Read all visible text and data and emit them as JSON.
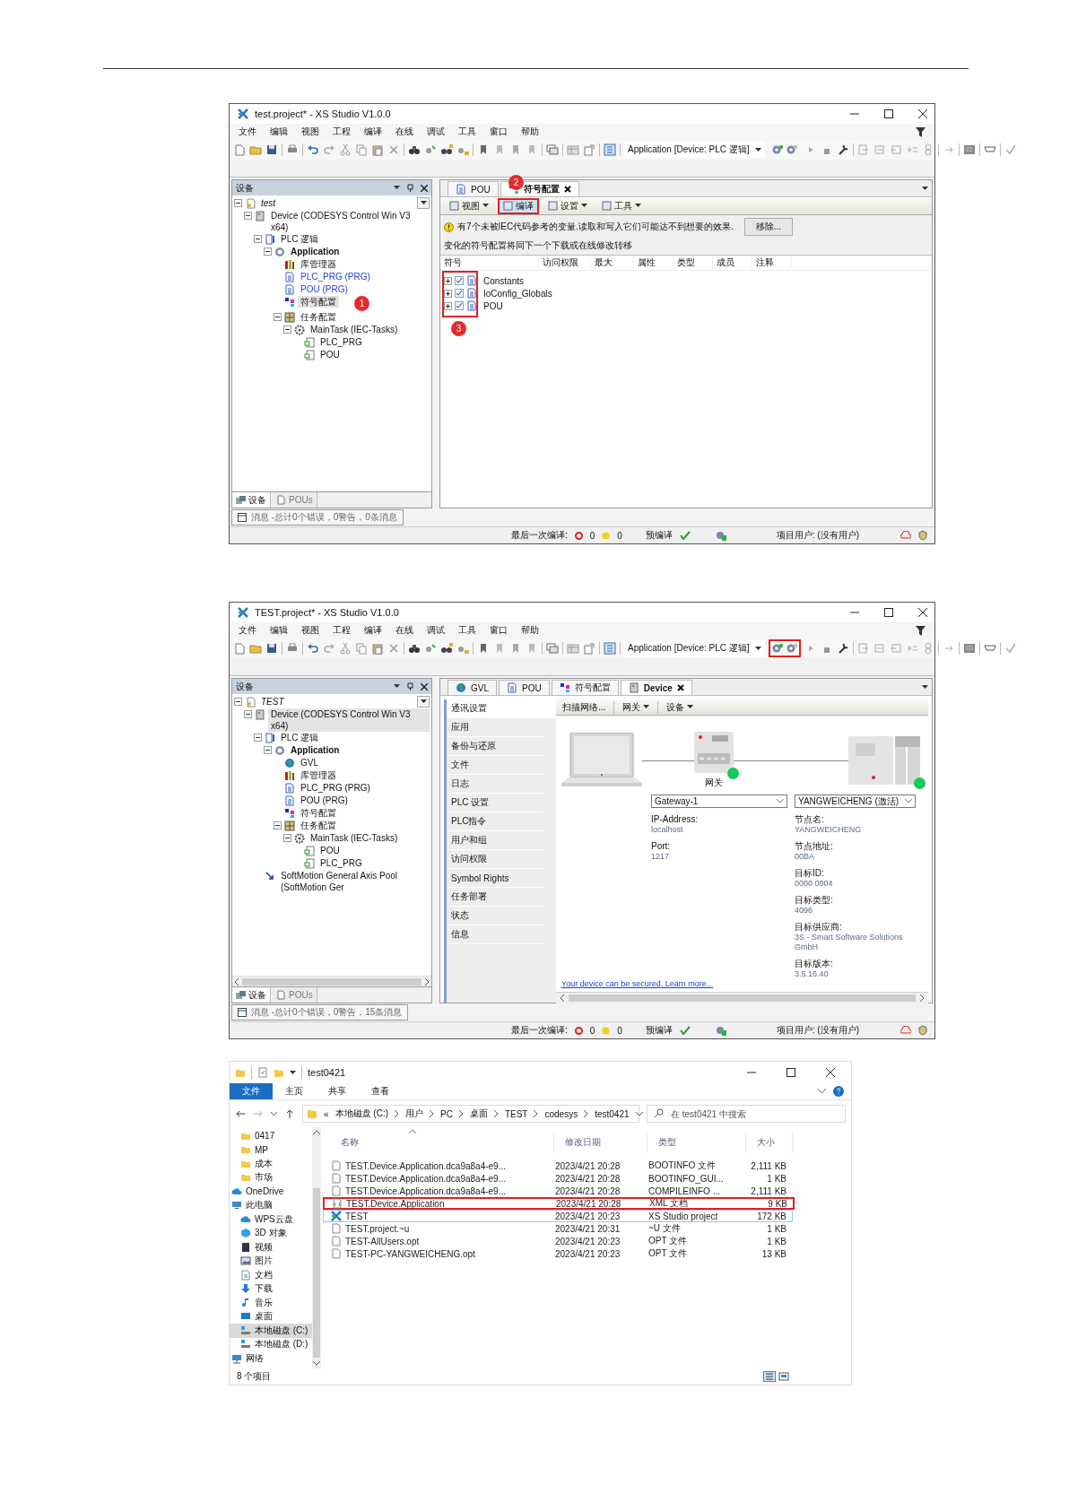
{
  "ide_windows": [
    {
      "title": "test.project* - XS Studio V1.0.0",
      "menu": [
        "文件",
        "编辑",
        "视图",
        "工程",
        "编译",
        "在线",
        "调试",
        "工具",
        "窗口",
        "帮助"
      ],
      "active_application": "Application [Device: PLC 逻辑]",
      "build_icon_highlighted": false,
      "device_panel": {
        "title": "设备",
        "tree": [
          {
            "label": "test",
            "kind": "project",
            "selected": false,
            "expanded": true,
            "children": [
              {
                "label": "Device (CODESYS Control Win V3 x64)",
                "kind": "device",
                "selected": false,
                "expanded": true,
                "children": [
                  {
                    "label": "PLC 逻辑",
                    "kind": "plc",
                    "selected": false,
                    "expanded": true,
                    "children": [
                      {
                        "label": "Application",
                        "kind": "application",
                        "selected": false,
                        "expanded": true,
                        "children": [
                          {
                            "label": "库管理器",
                            "kind": "library",
                            "selected": false
                          },
                          {
                            "label": "PLC_PRG (PRG)",
                            "kind": "pou",
                            "selected": false,
                            "color": "#2244dd"
                          },
                          {
                            "label": "POU (PRG)",
                            "kind": "pou",
                            "selected": false,
                            "color": "#2244dd"
                          },
                          {
                            "label": "符号配置",
                            "kind": "symbol",
                            "selected": true,
                            "badge": "1"
                          },
                          {
                            "label": "任务配置",
                            "kind": "taskconfig",
                            "selected": false,
                            "expanded": true,
                            "children": [
                              {
                                "label": "MainTask (IEC-Tasks)",
                                "kind": "task",
                                "selected": false,
                                "expanded": true,
                                "children": [
                                  {
                                    "label": "PLC_PRG",
                                    "kind": "call",
                                    "selected": false
                                  },
                                  {
                                    "label": "POU",
                                    "kind": "call",
                                    "selected": false
                                  }
                                ]
                              }
                            ]
                          }
                        ]
                      }
                    ]
                  }
                ]
              }
            ]
          }
        ],
        "tabs": [
          {
            "label": "设备",
            "selected": true
          },
          {
            "label": "POUs",
            "selected": false
          }
        ]
      },
      "messages_tab": "消息 -总计0个错误，0警告，0条消息",
      "editor_tabs": [
        {
          "label": "POU",
          "kind": "pou",
          "selected": false,
          "closable": false
        },
        {
          "label": "符号配置",
          "kind": "symbol",
          "selected": true,
          "closable": true
        }
      ],
      "editor": {
        "kind": "symbol_config",
        "toolbar": [
          {
            "label": "视图",
            "dropdown": true,
            "highlighted": false
          },
          {
            "label": "编译",
            "dropdown": false,
            "highlighted": true,
            "badge": "2"
          },
          {
            "label": "设置",
            "dropdown": true,
            "highlighted": false
          },
          {
            "label": "工具",
            "dropdown": true,
            "highlighted": false
          }
        ],
        "warning": "有7个未被IEC代码参考的变量.读取和写入它们可能达不到想要的效果.",
        "remove_button": "移除...",
        "note": "变化的符号配置将同下一个下载或在线修改转移",
        "columns": [
          "符号",
          "访问权限",
          "最大",
          "属性",
          "类型",
          "成员",
          "注释"
        ],
        "rows": [
          {
            "name": "Constants",
            "checked": true,
            "expanded": false
          },
          {
            "name": "IoConfig_Globals",
            "checked": true,
            "expanded": false
          },
          {
            "name": "POU",
            "checked": true,
            "expanded": false
          }
        ],
        "rows_highlighted": true,
        "rows_badge": "3"
      },
      "status_bar": {
        "last_build": "最后一次编译:",
        "errors": "0",
        "warnings": "0",
        "precompile": "预编译",
        "precompile_ok": true,
        "project_user": "项目用户: (没有用户)"
      }
    },
    {
      "title": "TEST.project* - XS Studio V1.0.0",
      "menu": [
        "文件",
        "编辑",
        "视图",
        "工程",
        "编译",
        "在线",
        "调试",
        "工具",
        "窗口",
        "帮助"
      ],
      "active_application": "Application [Device: PLC 逻辑]",
      "build_icon_highlighted": true,
      "device_panel": {
        "title": "设备",
        "tree_scrollbar": true,
        "tree": [
          {
            "label": "TEST",
            "kind": "project",
            "selected": false,
            "expanded": true,
            "children": [
              {
                "label": "Device (CODESYS Control Win V3 x64)",
                "kind": "device",
                "selected": true,
                "expanded": true,
                "children": [
                  {
                    "label": "PLC 逻辑",
                    "kind": "plc",
                    "selected": false,
                    "expanded": true,
                    "children": [
                      {
                        "label": "Application",
                        "kind": "application",
                        "selected": false,
                        "expanded": true,
                        "children": [
                          {
                            "label": "GVL",
                            "kind": "gvl",
                            "selected": false
                          },
                          {
                            "label": "库管理器",
                            "kind": "library",
                            "selected": false
                          },
                          {
                            "label": "PLC_PRG (PRG)",
                            "kind": "pou",
                            "selected": false
                          },
                          {
                            "label": "POU (PRG)",
                            "kind": "pou",
                            "selected": false
                          },
                          {
                            "label": "符号配置",
                            "kind": "symbol",
                            "selected": false
                          },
                          {
                            "label": "任务配置",
                            "kind": "taskconfig",
                            "selected": false,
                            "expanded": true,
                            "children": [
                              {
                                "label": "MainTask (IEC-Tasks)",
                                "kind": "task",
                                "selected": false,
                                "expanded": true,
                                "children": [
                                  {
                                    "label": "POU",
                                    "kind": "call",
                                    "selected": false
                                  },
                                  {
                                    "label": "PLC_PRG",
                                    "kind": "call",
                                    "selected": false
                                  }
                                ]
                              }
                            ]
                          }
                        ]
                      }
                    ]
                  },
                  {
                    "label": "SoftMotion General Axis Pool (SoftMotion Ger",
                    "kind": "axis",
                    "selected": false
                  }
                ]
              }
            ]
          }
        ],
        "tabs": [
          {
            "label": "设备",
            "selected": true
          },
          {
            "label": "POUs",
            "selected": false
          }
        ]
      },
      "messages_tab": "消息 -总计0个错误，0警告，15条消息",
      "editor_tabs": [
        {
          "label": "GVL",
          "kind": "gvl",
          "selected": false,
          "closable": false
        },
        {
          "label": "POU",
          "kind": "pou",
          "selected": false,
          "closable": false
        },
        {
          "label": "符号配置",
          "kind": "symbol",
          "selected": false,
          "closable": false
        },
        {
          "label": "Device",
          "kind": "device",
          "selected": true,
          "closable": true
        }
      ],
      "editor": {
        "kind": "device",
        "nav": [
          {
            "label": "通讯设置",
            "selected": true
          },
          {
            "label": "应用",
            "selected": false
          },
          {
            "label": "备份与还原",
            "selected": false
          },
          {
            "label": "文件",
            "selected": false
          },
          {
            "label": "日志",
            "selected": false
          },
          {
            "label": "PLC 设置",
            "selected": false
          },
          {
            "label": "PLC指令",
            "selected": false
          },
          {
            "label": "用户和组",
            "selected": false
          },
          {
            "label": "访问权限",
            "selected": false
          },
          {
            "label": "Symbol Rights",
            "selected": false
          },
          {
            "label": "任务部署",
            "selected": false
          },
          {
            "label": "状态",
            "selected": false
          },
          {
            "label": "信息",
            "selected": false
          }
        ],
        "toolbar": [
          {
            "label": "扫描网络...",
            "dropdown": false
          },
          {
            "label": "网关",
            "dropdown": true
          },
          {
            "label": "设备",
            "dropdown": true
          }
        ],
        "gateway": {
          "caption": "网关",
          "connected": true,
          "selection": "Gateway-1",
          "fields": [
            {
              "label": "IP-Address:",
              "value": "localhost"
            },
            {
              "label": "Port:",
              "value": "1217"
            }
          ]
        },
        "device": {
          "connected": true,
          "selection": "YANGWEICHENG (激活)",
          "fields": [
            {
              "label": "节点名:",
              "value": "YANGWEICHENG"
            },
            {
              "label": "节点地址:",
              "value": "00BA"
            },
            {
              "label": "目标ID:",
              "value": "0000 0004"
            },
            {
              "label": "目标类型:",
              "value": "4096"
            },
            {
              "label": "目标供应商:",
              "value": "3S - Smart Software Solutions GmbH"
            },
            {
              "label": "目标版本:",
              "value": "3.5.16.40"
            }
          ]
        },
        "link": "Your device can be secured. Learn more..."
      },
      "status_bar": {
        "last_build": "最后一次编译:",
        "errors": "0",
        "warnings": "0",
        "precompile": "预编译",
        "precompile_ok": true,
        "project_user": "项目用户: (没有用户)"
      }
    }
  ],
  "explorer": {
    "title": "test0421",
    "ribbon_tabs": [
      {
        "label": "文件",
        "selected": true
      },
      {
        "label": "主页",
        "selected": false
      },
      {
        "label": "共享",
        "selected": false
      },
      {
        "label": "查看",
        "selected": false
      }
    ],
    "path_overflow": "«",
    "path": [
      "本地磁盘 (C:)",
      "用户",
      "PC",
      "桌面",
      "TEST",
      "codesys",
      "test0421"
    ],
    "search": {
      "placeholder": "在 test0421 中搜索"
    },
    "nav": [
      {
        "label": "0417",
        "kind": "folder",
        "selected": false
      },
      {
        "label": "MP",
        "kind": "folder",
        "selected": false
      },
      {
        "label": "成本",
        "kind": "folder",
        "selected": false
      },
      {
        "label": "市场",
        "kind": "folder",
        "selected": false
      },
      {
        "label": "OneDrive",
        "kind": "cloud",
        "selected": false
      },
      {
        "label": "此电脑",
        "kind": "pc",
        "selected": false,
        "children": [
          {
            "label": "WPS云盘",
            "kind": "cloud",
            "selected": false
          },
          {
            "label": "3D 对象",
            "kind": "cube",
            "selected": false
          },
          {
            "label": "视频",
            "kind": "video",
            "selected": false
          },
          {
            "label": "图片",
            "kind": "picture",
            "selected": false
          },
          {
            "label": "文档",
            "kind": "document",
            "selected": false
          },
          {
            "label": "下载",
            "kind": "download",
            "selected": false
          },
          {
            "label": "音乐",
            "kind": "music",
            "selected": false
          },
          {
            "label": "桌面",
            "kind": "desktop",
            "selected": false
          },
          {
            "label": "本地磁盘 (C:)",
            "kind": "drive",
            "selected": true
          },
          {
            "label": "本地磁盘 (D:)",
            "kind": "drive",
            "selected": false
          }
        ]
      },
      {
        "label": "网络",
        "kind": "network",
        "selected": false
      }
    ],
    "columns": [
      "名称",
      "修改日期",
      "类型",
      "大小"
    ],
    "files": [
      {
        "name": "TEST.Device.Application.dca9a8a4-e9...",
        "date": "2023/4/21 20:28",
        "type": "BOOTINFO 文件",
        "size": "2,111 KB",
        "kind": "file",
        "highlighted": false,
        "focused": false
      },
      {
        "name": "TEST.Device.Application.dca9a8a4-e9...",
        "date": "2023/4/21 20:28",
        "type": "BOOTINFO_GUI...",
        "size": "1 KB",
        "kind": "file",
        "highlighted": false,
        "focused": false
      },
      {
        "name": "TEST.Device.Application.dca9a8a4-e9...",
        "date": "2023/4/21 20:28",
        "type": "COMPILEINFO ...",
        "size": "2,111 KB",
        "kind": "file",
        "highlighted": false,
        "focused": false
      },
      {
        "name": "TEST.Device.Application",
        "date": "2023/4/21 20:28",
        "type": "XML 文档",
        "size": "9 KB",
        "kind": "xml",
        "highlighted": true,
        "focused": false
      },
      {
        "name": "TEST",
        "date": "2023/4/21 20:23",
        "type": "XS Studio project",
        "size": "172 KB",
        "kind": "project",
        "highlighted": false,
        "focused": true
      },
      {
        "name": "TEST.project.~u",
        "date": "2023/4/21 20:31",
        "type": "~U 文件",
        "size": "1 KB",
        "kind": "file",
        "highlighted": false,
        "focused": false
      },
      {
        "name": "TEST-AllUsers.opt",
        "date": "2023/4/21 20:23",
        "type": "OPT 文件",
        "size": "1 KB",
        "kind": "file",
        "highlighted": false,
        "focused": false
      },
      {
        "name": "TEST-PC-YANGWEICHENG.opt",
        "date": "2023/4/21 20:23",
        "type": "OPT 文件",
        "size": "13 KB",
        "kind": "file",
        "highlighted": false,
        "focused": false
      }
    ],
    "item_count": "8 个项目"
  }
}
